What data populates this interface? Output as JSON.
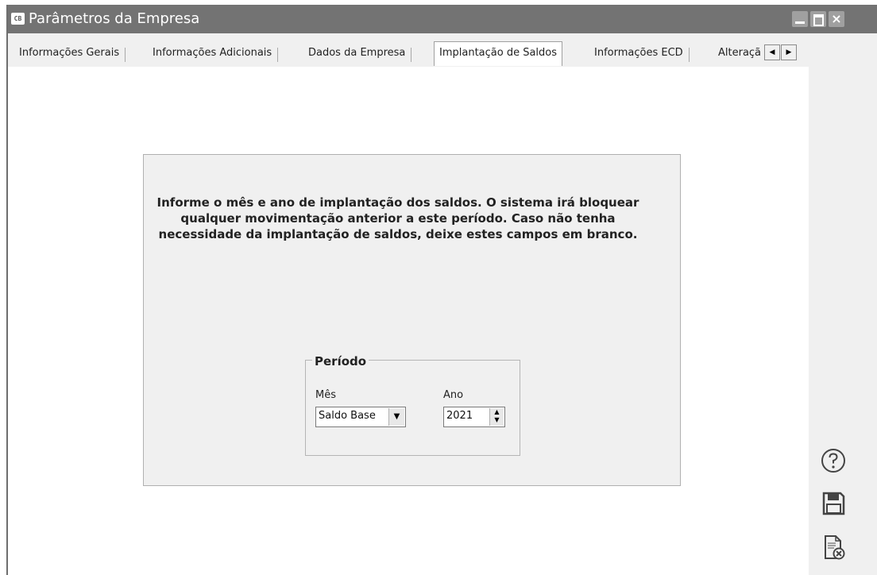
{
  "window": {
    "title": "Parâmetros da Empresa",
    "app_icon_text": "CB"
  },
  "tabs": [
    {
      "label": "Informações Gerais"
    },
    {
      "label": "Informações Adicionais"
    },
    {
      "label": "Dados da Empresa"
    },
    {
      "label": "Implantação de Saldos",
      "active": true
    },
    {
      "label": "Informações ECD"
    },
    {
      "label": "Alteraçã"
    }
  ],
  "panel": {
    "info_lines": [
      "Informe o mês e ano de implantação dos saldos. O sistema irá bloquear",
      "qualquer  movimentação anterior a este período. Caso não tenha",
      "necessidade da implantação de saldos, deixe estes campos em branco."
    ],
    "group_title": "Período",
    "mes_label": "Mês",
    "mes_value": "Saldo Base",
    "ano_label": "Ano",
    "ano_value": "2021"
  },
  "sidebar_icons": [
    "help-icon",
    "save-icon",
    "cancel-document-icon"
  ]
}
